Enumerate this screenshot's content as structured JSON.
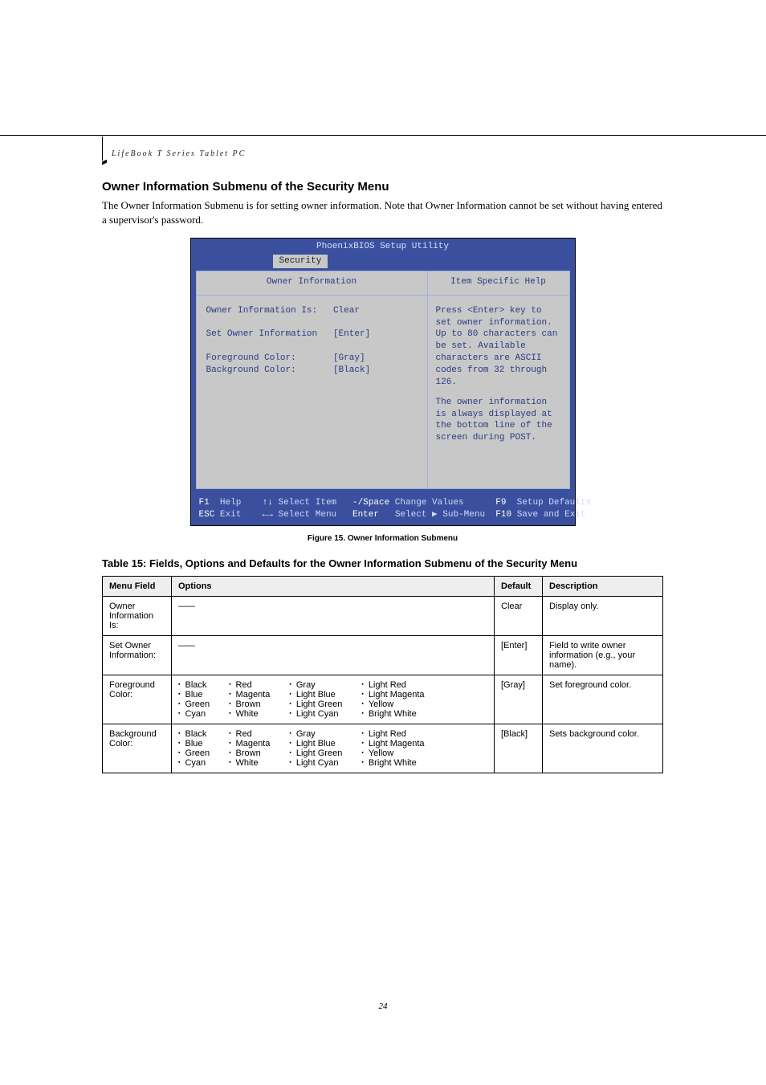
{
  "header": {
    "device_line": "LifeBook T Series Tablet PC"
  },
  "section": {
    "heading": "Owner Information Submenu of the Security Menu",
    "intro": "The Owner Information Submenu is for setting owner information. Note that Owner Information cannot be set without having entered a supervisor's password."
  },
  "bios": {
    "title": "PhoenixBIOS Setup Utility",
    "tab": "Security",
    "left_title": "Owner Information",
    "right_title": "Item Specific Help",
    "rows": [
      {
        "label": "Owner Information Is:",
        "value": "Clear"
      },
      {
        "label": "Set Owner Information",
        "value": "[Enter]"
      },
      {
        "label": "Foreground Color:",
        "value": "[Gray]"
      },
      {
        "label": "Background Color:",
        "value": "[Black]"
      }
    ],
    "help_p1": "Press <Enter> key to set owner information. Up to 80 characters can be set. Available characters are ASCII codes from 32 through 126.",
    "help_p2": "The owner information is always displayed at the bottom line of the screen during POST.",
    "footer": {
      "l1a": "F1",
      "l1b": "Help",
      "l1c": "↑↓",
      "l1d": "Select Item",
      "l1e": "-/Space",
      "l1f": "Change Values",
      "l1g": "F9",
      "l1h": "Setup Defaults",
      "l2a": "ESC",
      "l2b": "Exit",
      "l2c": "←→",
      "l2d": "Select Menu",
      "l2e": "Enter",
      "l2f": "Select ▶ Sub-Menu",
      "l2g": "F10",
      "l2h": "Save and Exit"
    }
  },
  "figure_caption": "Figure 15.   Owner Information Submenu",
  "table_caption": "Table 15: Fields, Options and Defaults for the Owner Information Submenu of the Security Menu",
  "table": {
    "headers": {
      "c1": "Menu Field",
      "c2": "Options",
      "c3": "Default",
      "c4": "Description"
    },
    "rows": [
      {
        "field": "Owner Information Is:",
        "options_dash": "——",
        "default": "Clear",
        "desc": "Display only."
      },
      {
        "field": "Set Owner Information:",
        "options_dash": "——",
        "default": "[Enter]",
        "desc": "Field to write owner information (e.g., your name)."
      },
      {
        "field": "Foreground Color:",
        "default": "[Gray]",
        "desc": "Set foreground color."
      },
      {
        "field": "Background Color:",
        "default": "[Black]",
        "desc": "Sets background color."
      }
    ],
    "color_groups": [
      [
        "Black",
        "Blue",
        "Green",
        "Cyan"
      ],
      [
        "Red",
        "Magenta",
        "Brown",
        "White"
      ],
      [
        "Gray",
        "Light Blue",
        "Light Green",
        "Light Cyan"
      ],
      [
        "Light Red",
        "Light Magenta",
        "Yellow",
        "Bright White"
      ]
    ]
  },
  "page_number": "24"
}
